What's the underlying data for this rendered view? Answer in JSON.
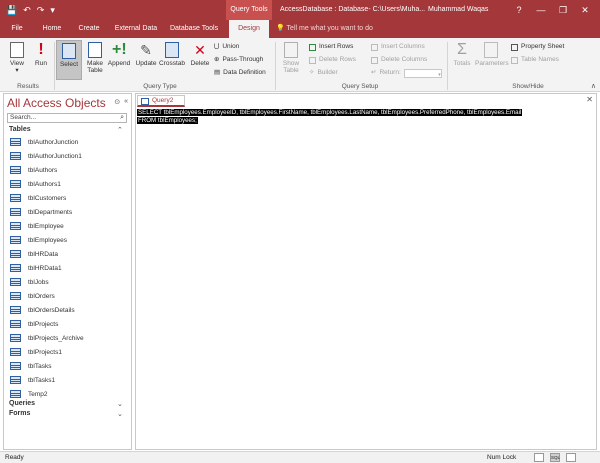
{
  "titlebar": {
    "context_tab": "Query Tools",
    "doc_title": "AccessDatabase : Database- C:\\Users\\Muha...",
    "user": "Muhammad Waqas",
    "help_icon": "?",
    "minimize_icon": "—",
    "restore_icon": "❐",
    "close_icon": "✕"
  },
  "tabs": [
    "File",
    "Home",
    "Create",
    "External Data",
    "Database Tools",
    "Design"
  ],
  "tell_me": "Tell me what you want to do",
  "ribbon": {
    "results": {
      "view": "View",
      "run": "Run",
      "group": "Results"
    },
    "query_type": {
      "select": "Select",
      "make_table_1": "Make",
      "make_table_2": "Table",
      "append": "Append",
      "update": "Update",
      "crosstab": "Crosstab",
      "delete": "Delete",
      "union": "Union",
      "pass_through": "Pass-Through",
      "data_definition": "Data Definition",
      "group": "Query Type"
    },
    "query_setup": {
      "show_table_1": "Show",
      "show_table_2": "Table",
      "insert_rows": "Insert Rows",
      "delete_rows": "Delete Rows",
      "builder": "Builder",
      "insert_columns": "Insert Columns",
      "delete_columns": "Delete Columns",
      "return": "Return:",
      "group": "Query Setup"
    },
    "show_hide": {
      "totals": "Totals",
      "parameters": "Parameters",
      "property_sheet": "Property Sheet",
      "table_names": "Table Names",
      "group": "Show/Hide"
    }
  },
  "nav": {
    "title": "All Access Objects",
    "search_placeholder": "Search...",
    "sections": {
      "tables": "Tables",
      "queries": "Queries",
      "forms": "Forms"
    },
    "tables": [
      "tblAuthorJunction",
      "tblAuthorJunction1",
      "tblAuthors",
      "tblAuthors1",
      "tblCustomers",
      "tblDepartments",
      "tblEmployee",
      "tblEmployees",
      "tblHRData",
      "tblHRData1",
      "tblJobs",
      "tblOrders",
      "tblOrdersDetails",
      "tblProjects",
      "tblProjects_Archive",
      "tblProjects1",
      "tblTasks",
      "tblTasks1",
      "Temp2"
    ]
  },
  "query": {
    "tab_label": "Query2",
    "sql_line1": "SELECT tblEmployees.EmployeeID, tblEmployees.FirstName, tblEmployees.LastName, tblEmployees.PreferredPhone, tblEmployees.Email",
    "sql_line2": "FROM tblEmployees;"
  },
  "status": {
    "left": "Ready",
    "num_lock": "Num Lock",
    "sql_view": "SQL"
  },
  "colors": {
    "accent": "#a4373a",
    "table_icon": "#2f5fa0"
  }
}
